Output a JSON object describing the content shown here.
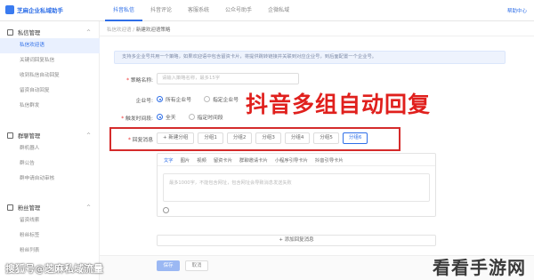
{
  "app": {
    "logo_text": "芝麻企业私域助手",
    "nav": [
      "抖音私信",
      "抖音评论",
      "客服系统",
      "公众号助手",
      "企微私域"
    ],
    "top_right": "帮助中心"
  },
  "sidebar": {
    "groups": [
      {
        "title": "私信管理",
        "items": [
          "私信欢迎语",
          "关键词回复私信",
          "收到私信自动回复",
          "留资自动回复",
          "私信群发"
        ]
      },
      {
        "title": "群聊管理",
        "items": [
          "群机器人",
          "群公告",
          "群申请自动审核"
        ]
      },
      {
        "title": "粉丝管理",
        "items": [
          "留资线索",
          "粉丝标签",
          "粉丝列表"
        ]
      }
    ]
  },
  "breadcrumb": {
    "parent": "私信欢迎语",
    "current": "新建欢迎语策略"
  },
  "form": {
    "notice": "支持多企业号共用一个策略，如果欢迎语中包含留资卡片，将提供跳转链接并关联到对应企业号，到后面配置一个企业号。",
    "name_label": "策略名称:",
    "name_placeholder": "请输入策略名称，最多15字",
    "account_label": "企业号:",
    "account_options": [
      "所有企业号",
      "指定企业号"
    ],
    "time_label": "触发时间段:",
    "time_options": [
      "全天",
      "指定时间段"
    ],
    "reply_label": "回复消息",
    "groups": [
      "+ 新建分组",
      "分组1",
      "分组2",
      "分组3",
      "分组4",
      "分组5",
      "分组6"
    ],
    "active_group_index": 6,
    "tools": [
      "文字",
      "图片",
      "视频",
      "留资卡片",
      "群聊邀请卡片",
      "小程序引导卡片",
      "抖音引导卡片"
    ],
    "textarea_placeholder": "最多1000字，不能包含网址，包含网址会导致消息发送失败",
    "add_reply": "+ 添加回复消息",
    "save": "保存",
    "cancel": "取消"
  },
  "overlay_title": "抖音多组自动回复",
  "watermarks": {
    "left": "搜狐号@芝麻私域流量",
    "right": "看看手游网"
  },
  "colors": {
    "accent": "#2f6fe8",
    "highlight_red": "#d52b2b",
    "overlay_red": "#e0201d"
  }
}
